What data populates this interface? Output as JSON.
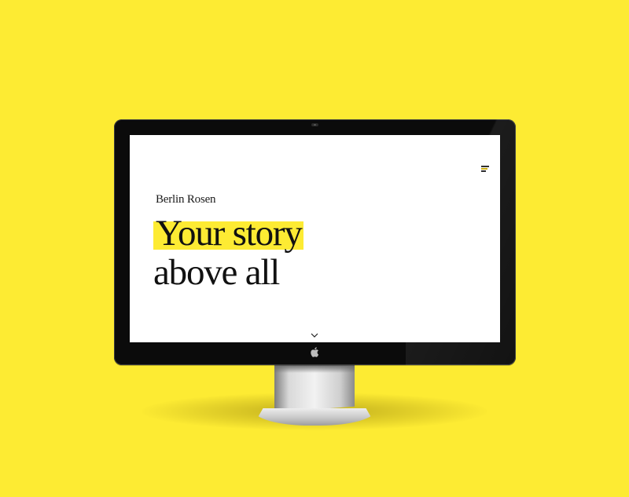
{
  "background_color": "#FDEB33",
  "accent_color": "#FDEB33",
  "website": {
    "logo": "Berlin Rosen",
    "headline": {
      "line1": "Your story",
      "line2": "above all"
    },
    "menu_icon": "hamburger-menu-icon",
    "scroll_icon": "chevron-down-icon"
  },
  "device": {
    "type": "desktop monitor",
    "logo_icon": "apple-icon"
  }
}
